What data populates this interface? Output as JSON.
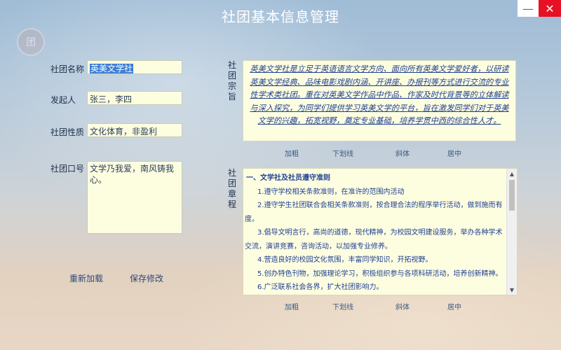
{
  "window": {
    "title": "社团基本信息管理",
    "minimize_glyph": "—",
    "close_glyph": "✕",
    "logo_icon": "club-logo-icon"
  },
  "form": {
    "name_label": "社团名称",
    "name_value": "英美文学社",
    "founder_label": "发起人",
    "founder_value": "张三，李四",
    "nature_label": "社团性质",
    "nature_value": "文化体育，非盈利",
    "slogan_label": "社团口号",
    "slogan_value": "文学乃我爱，南风铸我心。"
  },
  "purpose": {
    "label": "社团宗旨",
    "text": "英美文学社是立足于英语语言文学方向、面向所有英美文学爱好者，以研读英美文学经典、品味电影戏剧内涵、开讲座、办报刊等方式进行交流的专业性学术类社团。重在对英美文学作品中作品、作家及时代背景等的立体解读与深入探究，为同学们提供学习英美文学的平台，旨在激发同学们对于英美文学的兴趣，拓宽视野，奠定专业基础，培养学贯中西的综合性人才。"
  },
  "toolbar_purpose": {
    "bold": "加粗",
    "underline": "下划线",
    "italic": "斜体",
    "center": "居中"
  },
  "rules": {
    "label": "社团章程",
    "title": "一、文学社及社员遵守准则",
    "items": [
      "1.遵守学校相关条款准则，在准许的范围内活动",
      "2.遵守学生社团联合会相关条款准则，按合理合法的程序举行活动，做到施而有度。",
      "3.倡导文明言行，高尚的道德，现代精神，为校园文明建设服务，举办各种学术交流，演讲竞赛，咨询活动，以加强专业修养。",
      "4.营造良好的校园文化氛围，丰富同学知识，开拓视野。",
      "5.创办特色刊物，加强理论学习，积极组织参与各项科研活动，培养创新精神。",
      "6.广泛联系社会各界，扩大社团影响力。"
    ]
  },
  "toolbar_rules": {
    "bold": "加粗",
    "underline": "下划线",
    "italic": "斜体",
    "center": "居中"
  },
  "actions": {
    "reload": "重新加载",
    "save": "保存修改"
  },
  "scrollbar": {
    "up_glyph": "▲",
    "down_glyph": "▼"
  }
}
